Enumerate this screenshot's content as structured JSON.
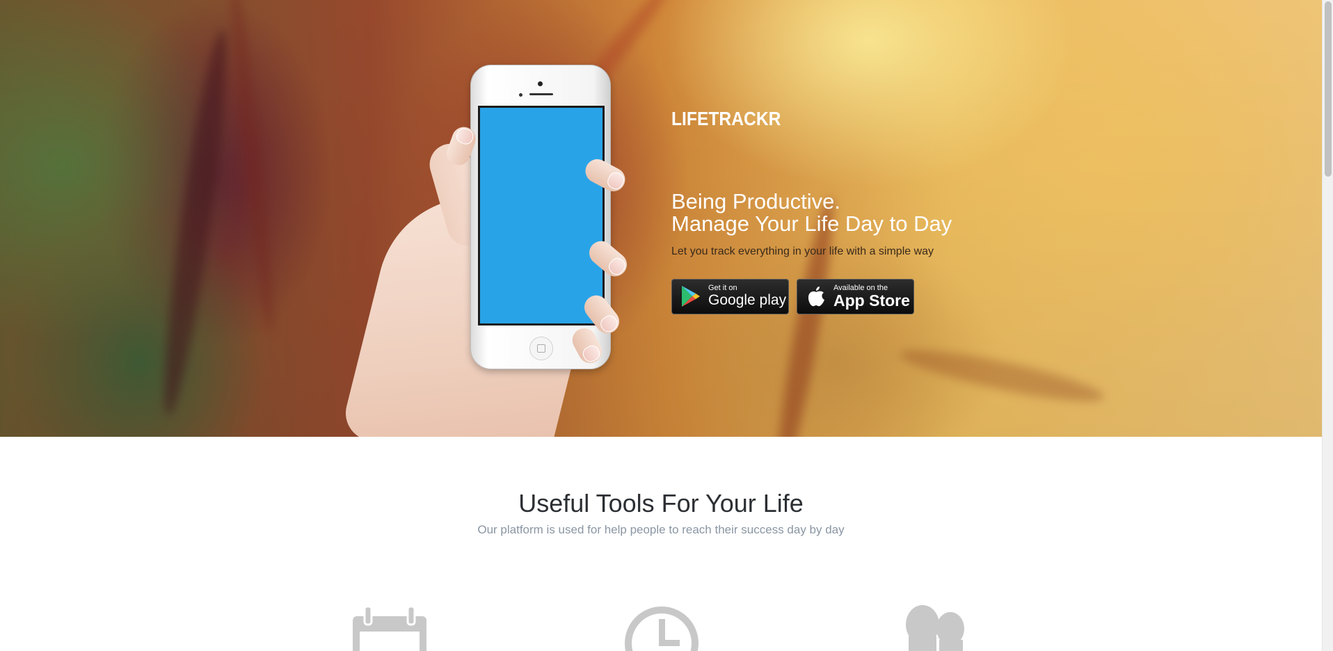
{
  "brand": {
    "name": "LIFETRACKR"
  },
  "hero": {
    "headline_line1": "Being Productive.",
    "headline_line2": "Manage Your Life Day to Day",
    "tagline": "Let you track everything in your life with a simple way",
    "phone_screen_color": "#29a3e8"
  },
  "store_buttons": {
    "google": {
      "small": "Get it on",
      "big": "Google play",
      "icon": "google-play-icon"
    },
    "apple": {
      "small": "Available on the",
      "big": "App Store",
      "icon": "apple-icon"
    }
  },
  "features": {
    "title": "Useful Tools For Your Life",
    "subtitle": "Our platform is used for help people to reach their success day by day",
    "icons": [
      "calendar-icon",
      "clock-icon",
      "users-icon"
    ],
    "icon_color": "#c8c8c8"
  },
  "colors": {
    "title_text": "#2b2f33",
    "subtitle_text": "#8a96a3",
    "button_bg": "#111111"
  }
}
